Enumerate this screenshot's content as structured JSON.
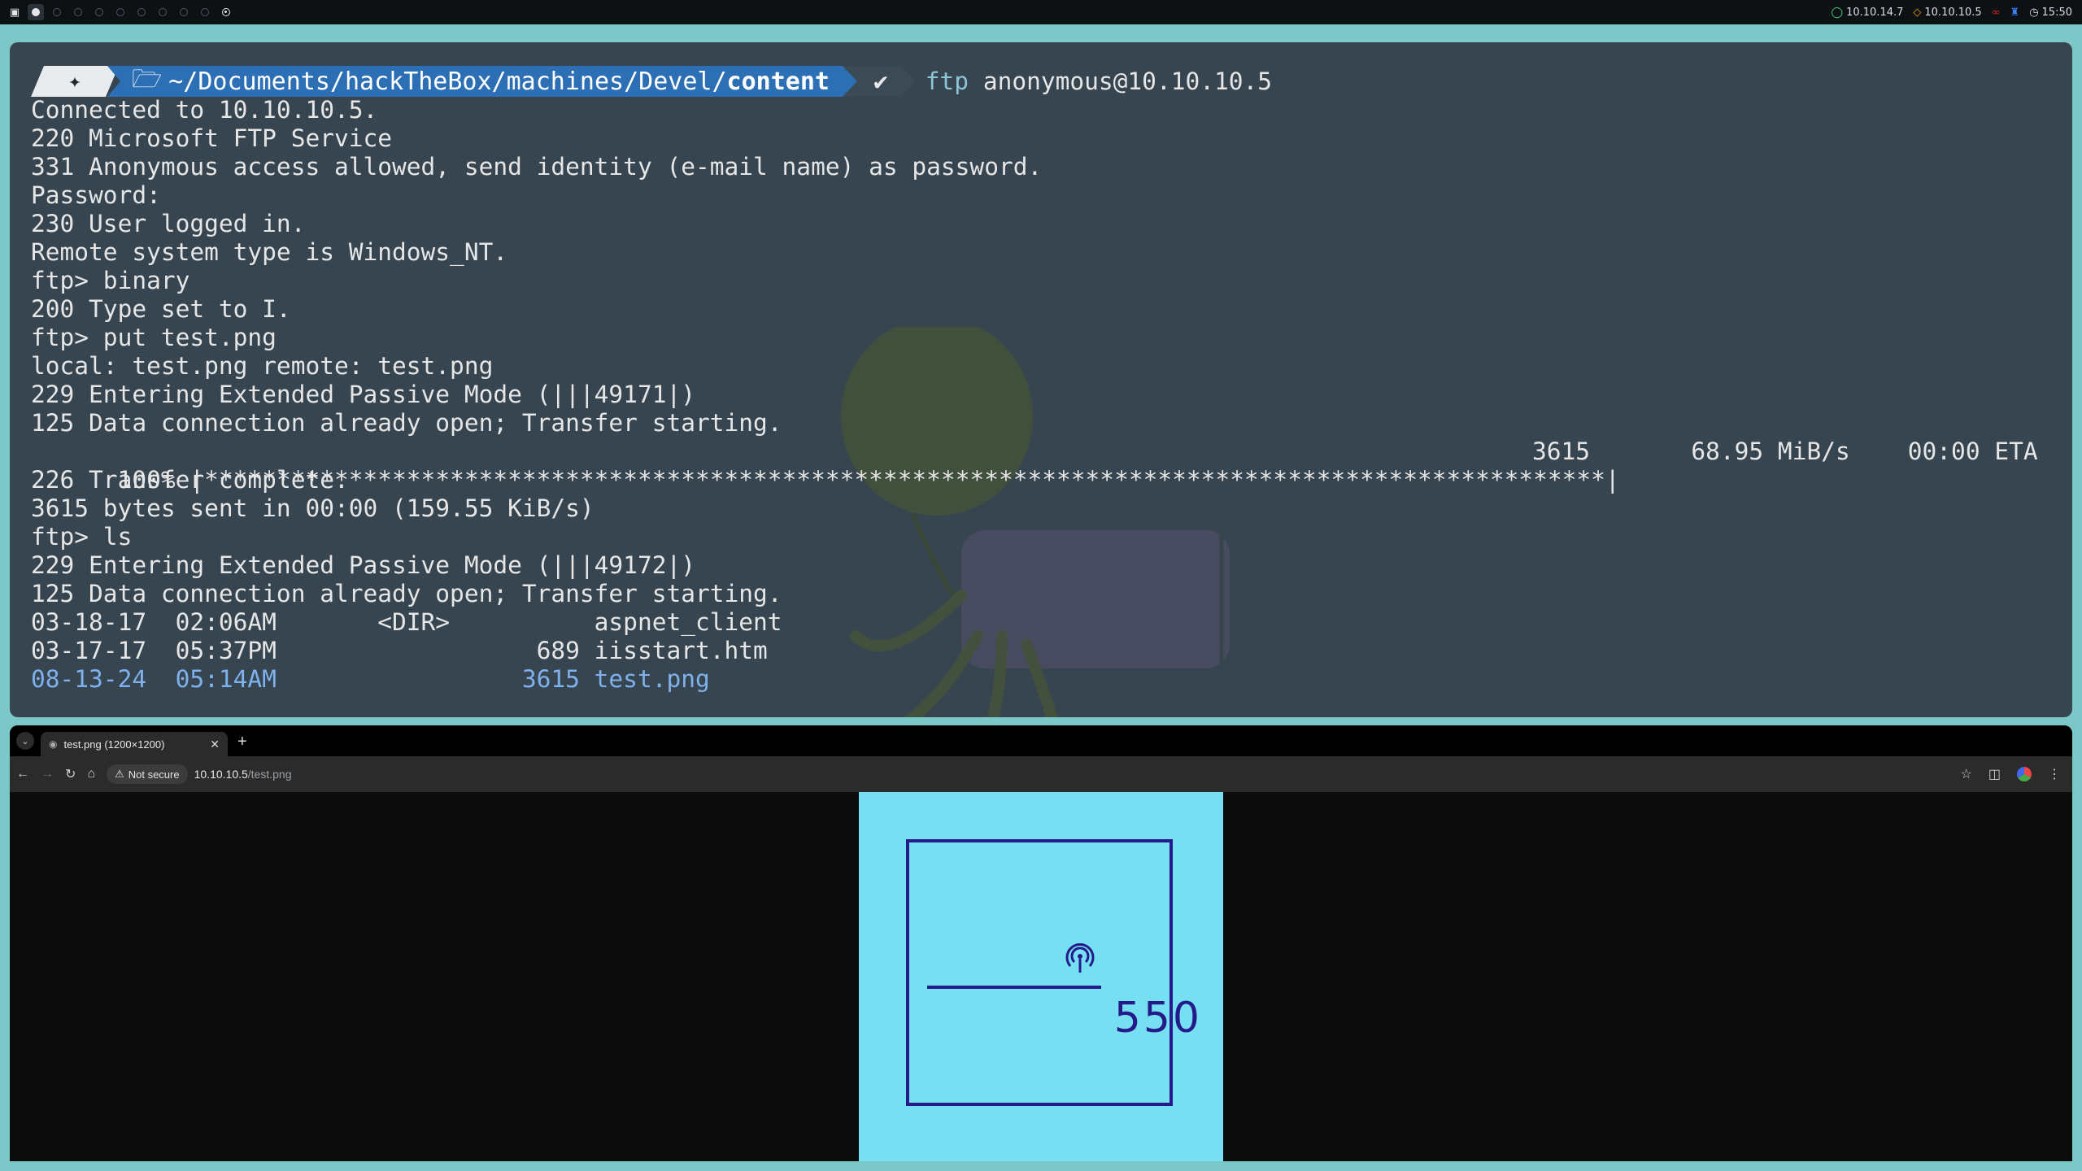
{
  "topbar": {
    "workspaces": [
      "1",
      "2",
      "3",
      "4",
      "5",
      "6",
      "7",
      "8",
      "9",
      "10"
    ],
    "tray": {
      "vpn_ip": "10.10.14.7",
      "target_ip": "10.10.10.5",
      "time": "15:50"
    },
    "colors": {
      "vpn": "#4ade80",
      "target": "#f59e0b",
      "net": "#3b82f6",
      "rec": "#dc2626"
    }
  },
  "terminal": {
    "prompt": {
      "icon": "kali-dragon-icon",
      "folder_icon": "folder-open-icon",
      "path_prefix": "~/Documents/hackTheBox/machines/Devel/",
      "path_current": "content",
      "status": "✔",
      "command_bin": "ftp",
      "command_args": "anonymous@10.10.10.5"
    },
    "lines": [
      "Connected to 10.10.10.5.",
      "220 Microsoft FTP Service",
      "331 Anonymous access allowed, send identity (e-mail name) as password.",
      "Password:",
      "230 User logged in.",
      "Remote system type is Windows_NT.",
      "ftp> binary",
      "200 Type set to I.",
      "ftp> put test.png",
      "local: test.png remote: test.png",
      "229 Entering Extended Passive Mode (|||49171|)",
      "125 Data connection already open; Transfer starting."
    ],
    "progress": {
      "percent": "100%",
      "bar": "|*************************************************************************************************|",
      "stats": "3615       68.95 MiB/s    00:00 ETA"
    },
    "lines2": [
      "226 Transfer complete.",
      "3615 bytes sent in 00:00 (159.55 KiB/s)",
      "ftp> ls",
      "229 Entering Extended Passive Mode (|||49172|)",
      "125 Data connection already open; Transfer starting."
    ],
    "listing": [
      "03-18-17  02:06AM       <DIR>          aspnet_client",
      "03-17-17  05:37PM                  689 iisstart.htm",
      "08-13-24  05:14AM                 3615 test.png"
    ]
  },
  "browser": {
    "tab_title": "test.png (1200×1200)",
    "new_tab": "+",
    "security_label": "Not secure",
    "url_host": "10.10.10.5",
    "url_path": "/test.png",
    "image_number": "550",
    "image_colors": {
      "bg": "#76e0f2",
      "ink": "#241a8a"
    }
  }
}
